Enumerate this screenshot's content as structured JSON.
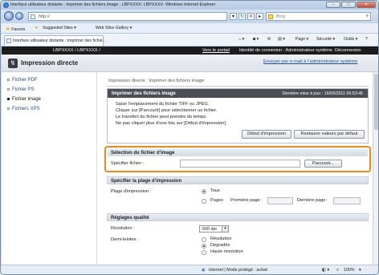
{
  "window": {
    "title": "Interface utilisateur distante : Imprimer des fichiers image : LBPXXXX: LBPXXXX- Windows Internet Explorer",
    "minimize": "–",
    "maximize": "□",
    "close": "✕"
  },
  "addressbar": {
    "url": "http://",
    "search_placeholder": "Bing"
  },
  "favorites": {
    "favorites_label": "Favoris",
    "suggested_sites": "Suggested Sites ▾",
    "web_slice_gallery": "Web Slice Gallery ▾"
  },
  "tab": {
    "label": "Interface utilisateur distante : Imprimer des fichie..."
  },
  "commandbar": {
    "page": "Page ▾",
    "securite": "Sécurité ▾",
    "outils": "Outils ▾",
    "help": "?"
  },
  "topbar": {
    "device": "LBPXXXX / LBPXXXX /",
    "portal": "Vers le portail",
    "identity": "Identité de connexion : Administrateur système",
    "logout": "Déconnexion"
  },
  "header": {
    "title": "Impression directe",
    "mail_link": "Envoyer par e-mail à l'administrateur système"
  },
  "sidebar": {
    "items": [
      {
        "label": "Fichier PDF"
      },
      {
        "label": "Fichier PS"
      },
      {
        "label": "Fichier image"
      },
      {
        "label": "Fichiers XPS"
      }
    ]
  },
  "main": {
    "breadcrumb": "Impression directe : Imprimer des fichiers image",
    "panel_title": "Imprimer des fichiers image",
    "last_update": "Dernière mise à jour : 16/09/2011 06:53:45",
    "instructions": [
      "Saisir l'emplacement du fichier TIFF ou JPEG.",
      "Cliquer sur [Parcourir] pour sélectionner un fichier.",
      "Le transfert du fichier peut prendre du temps.",
      "Ne pas cliquer plus d'une fois sur [Début d'impression]."
    ],
    "start_print_button": "Début d'impression",
    "restore_defaults_button": "Restaurer valeurs par défaut",
    "file_section": {
      "title": "Sélection du fichier d'image",
      "label": "Spécifier fichier :",
      "browse_button": "Parcourir..."
    },
    "range_section": {
      "title": "Spécifier la plage d'impression",
      "label": "Plage d'impression :",
      "option_all": "Tous",
      "option_pages": "Pages",
      "first_page_label": "Première page :",
      "last_page_label": "Dernière page :"
    },
    "quality_section": {
      "title": "Réglages qualité",
      "resolution_label": "Résolution :",
      "resolution_value": "600 dpi",
      "halftone_label": "Demi-teintes :",
      "halftone_options": [
        "Résolution",
        "Dégradés",
        "Haute résolution"
      ]
    }
  },
  "statusbar": {
    "zone": "Internet | Mode protégé : activé",
    "zoom": "100%"
  }
}
